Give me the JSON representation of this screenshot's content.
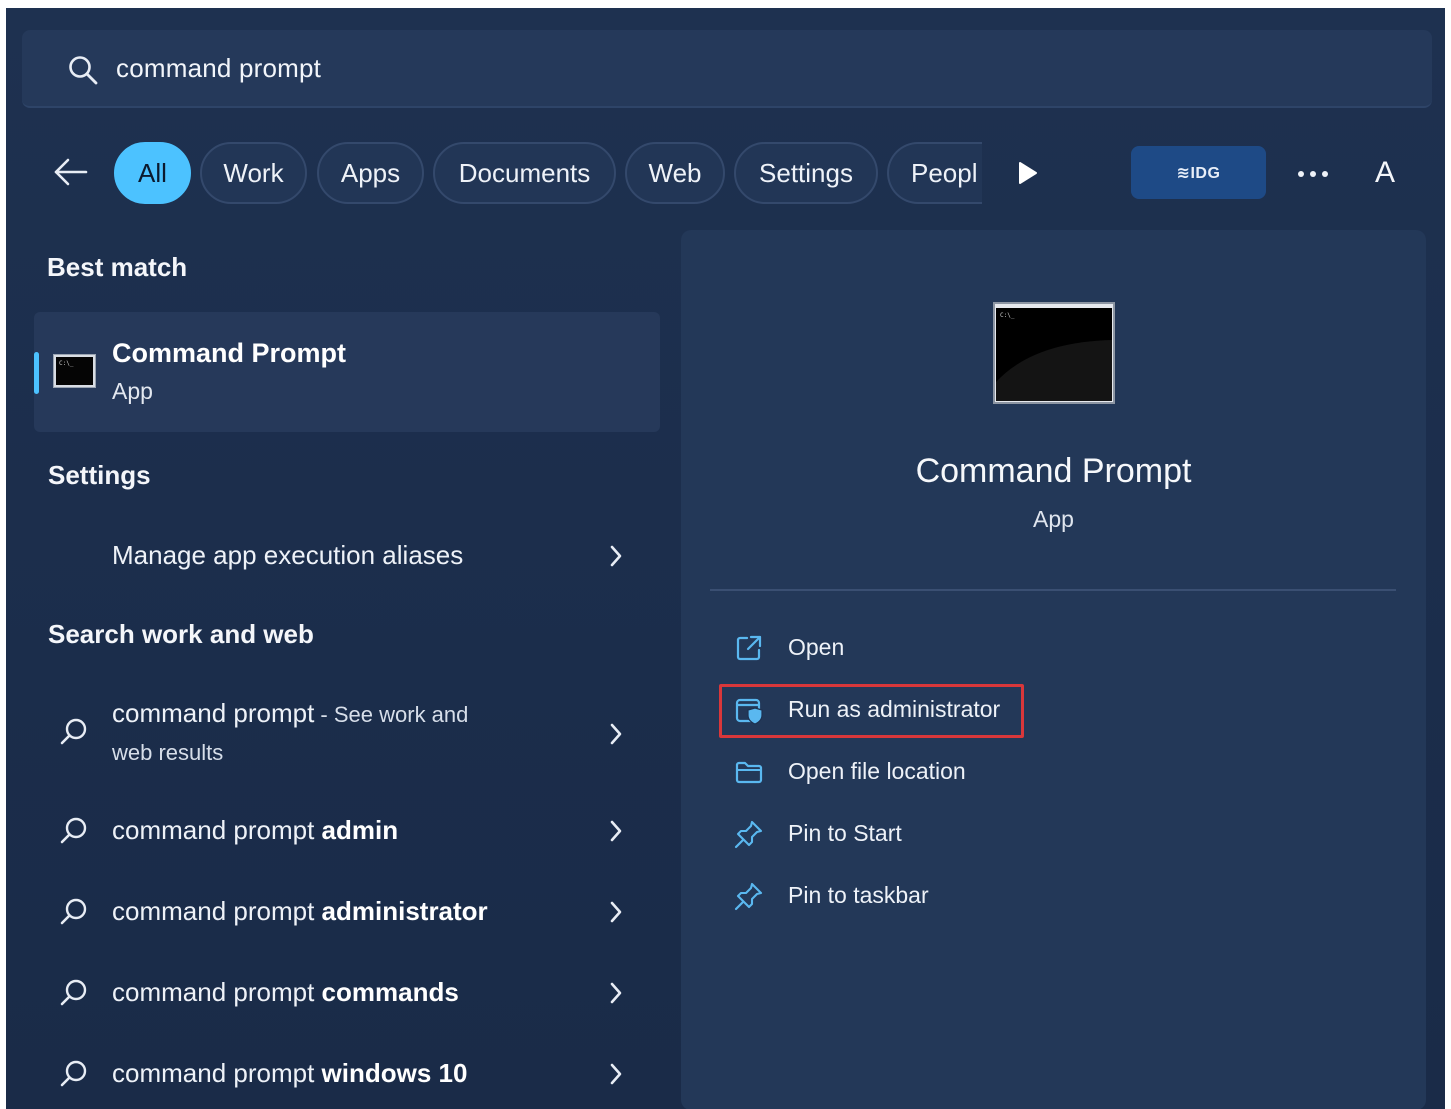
{
  "search": {
    "query": "command prompt"
  },
  "filters": {
    "items": [
      "All",
      "Work",
      "Apps",
      "Documents",
      "Web",
      "Settings",
      "Peopl"
    ],
    "active": "All"
  },
  "badge": {
    "label": "≋IDG"
  },
  "account": {
    "initial": "A"
  },
  "left": {
    "best_match_heading": "Best match",
    "best_match": {
      "title": "Command Prompt",
      "type": "App"
    },
    "settings_heading": "Settings",
    "settings_items": [
      {
        "label": "Manage app execution aliases"
      }
    ],
    "web_heading": "Search work and web",
    "web_items": [
      {
        "prefix": "command prompt",
        "bold": "",
        "suffix": " - See work and",
        "line2": "web results"
      },
      {
        "prefix": "command prompt ",
        "bold": "admin"
      },
      {
        "prefix": "command prompt ",
        "bold": "administrator"
      },
      {
        "prefix": "command prompt ",
        "bold": "commands"
      },
      {
        "prefix": "command prompt ",
        "bold": "windows 10"
      }
    ]
  },
  "preview": {
    "title": "Command Prompt",
    "type": "App",
    "actions": [
      {
        "label": "Open",
        "icon": "open-external-icon"
      },
      {
        "label": "Run as administrator",
        "icon": "shield-admin-icon",
        "highlighted": true
      },
      {
        "label": "Open file location",
        "icon": "folder-icon"
      },
      {
        "label": "Pin to Start",
        "icon": "pin-icon"
      },
      {
        "label": "Pin to taskbar",
        "icon": "pin-icon"
      }
    ]
  },
  "colors": {
    "background": "#1b2d4b",
    "accent": "#4cc2ff",
    "highlight_border": "#d9373a"
  }
}
